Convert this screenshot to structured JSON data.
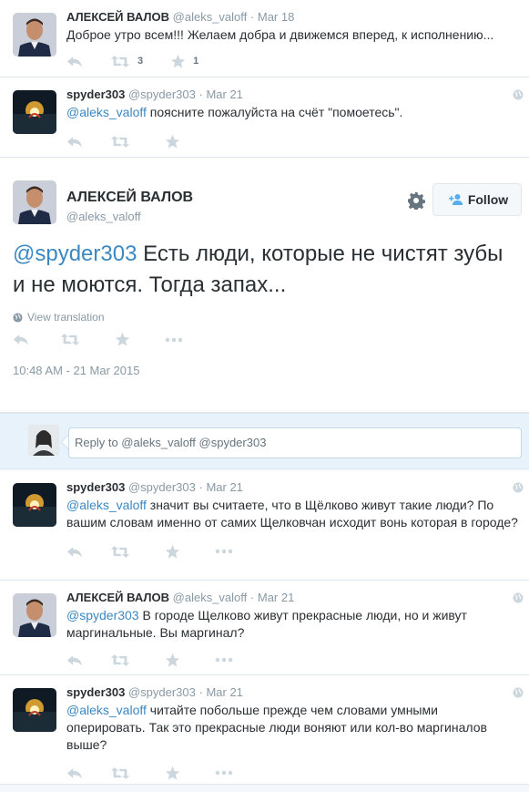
{
  "tweets_above": [
    {
      "name": "АЛЕКСЕЙ ВАЛОВ",
      "handle": "@aleks_valoff",
      "sep": "·",
      "date": "Mar 18",
      "text": "Доброе утро всем!!! Желаем добра и движемся вперед, к исполнению...",
      "retweets": "3",
      "favorites": "1"
    },
    {
      "name": "spyder303",
      "handle": "@spyder303",
      "sep": "·",
      "date": "Mar 21",
      "mention": "@aleks_valoff",
      "text": " поясните пожалуйста на счёт \"помоетесь\"."
    }
  ],
  "permalink": {
    "name": "АЛЕКСЕЙ ВАЛОВ",
    "handle": "@aleks_valoff",
    "follow_label": "Follow",
    "mention": "@spyder303",
    "text": " Есть люди, которые не чистят зубы и не моются. Тогда запах...",
    "view_translation": "View translation",
    "timestamp": "10:48 AM - 21 Mar 2015"
  },
  "reply_box": {
    "placeholder": "Reply to @aleks_valoff @spyder303"
  },
  "replies": [
    {
      "name": "spyder303",
      "handle": "@spyder303",
      "sep": "·",
      "date": "Mar 21",
      "mention": "@aleks_valoff",
      "text": " значит вы считаете, что в Щёлково живут такие люди? По вашим словам именно от самих Щелковчан исходит вонь которая в городе?"
    },
    {
      "name": "АЛЕКСЕЙ ВАЛОВ",
      "handle": "@aleks_valoff",
      "sep": "·",
      "date": "Mar 21",
      "mention": "@spyder303",
      "text": " В городе Щелково живут прекрасные люди, но и живут маргинальные. Вы маргинал?"
    },
    {
      "name": "spyder303",
      "handle": "@spyder303",
      "sep": "·",
      "date": "Mar 21",
      "mention": "@aleks_valoff",
      "text": " читайте побольше прежде чем словами умными оперировать. Так это прекрасные люди воняют или кол-во маргиналов выше?"
    }
  ],
  "colors": {
    "link": "#3b88c3",
    "muted": "#8899a6",
    "icon": "#ccd6dd",
    "reply_bg": "#e8f2fa"
  },
  "icons": [
    "reply-icon",
    "retweet-icon",
    "favorite-icon",
    "more-icon",
    "globe-icon",
    "gear-icon",
    "follow-user-icon"
  ]
}
